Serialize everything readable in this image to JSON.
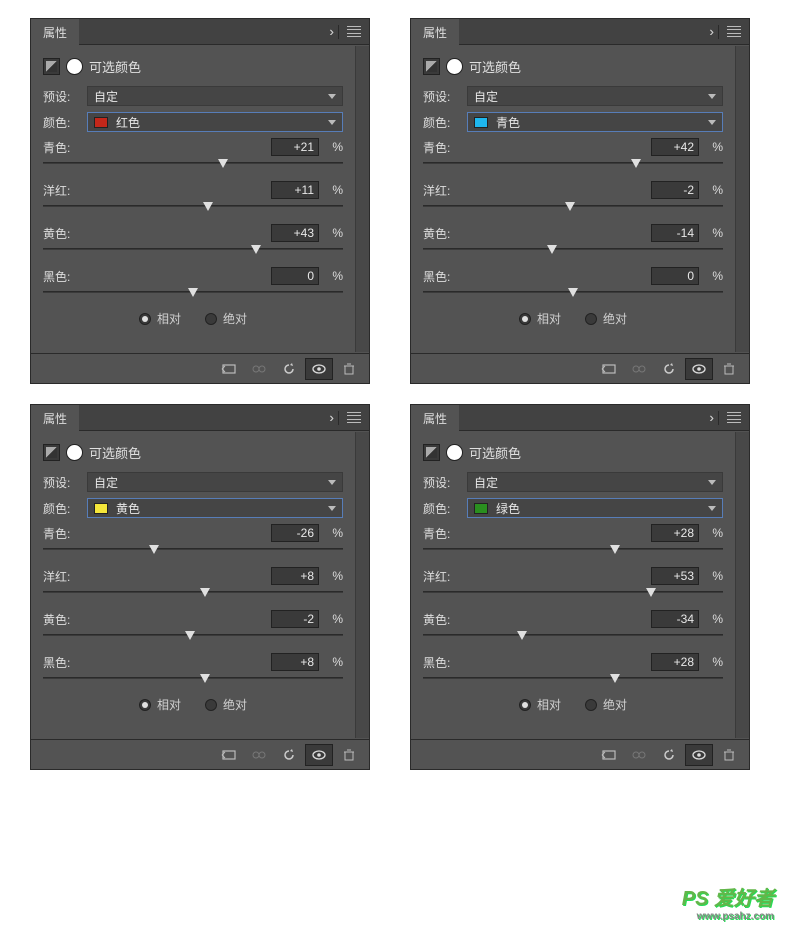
{
  "panels": [
    {
      "header": "属性",
      "title": "可选颜色",
      "preset_label": "预设:",
      "preset_value": "自定",
      "color_label": "颜色:",
      "color_value": "红色",
      "swatch": "#c3271a",
      "sliders": [
        {
          "label": "青色:",
          "value": "+21",
          "pct": "%",
          "pos": 60
        },
        {
          "label": "洋红:",
          "value": "+11",
          "pct": "%",
          "pos": 55
        },
        {
          "label": "黄色:",
          "value": "+43",
          "pct": "%",
          "pos": 71
        },
        {
          "label": "黑色:",
          "value": "0",
          "pct": "%",
          "pos": 50
        }
      ],
      "radio_rel": "相对",
      "radio_abs": "绝对"
    },
    {
      "header": "属性",
      "title": "可选颜色",
      "preset_label": "预设:",
      "preset_value": "自定",
      "color_label": "颜色:",
      "color_value": "青色",
      "swatch": "#1fb7ee",
      "sliders": [
        {
          "label": "青色:",
          "value": "+42",
          "pct": "%",
          "pos": 71
        },
        {
          "label": "洋红:",
          "value": "-2",
          "pct": "%",
          "pos": 49
        },
        {
          "label": "黄色:",
          "value": "-14",
          "pct": "%",
          "pos": 43
        },
        {
          "label": "黑色:",
          "value": "0",
          "pct": "%",
          "pos": 50
        }
      ],
      "radio_rel": "相对",
      "radio_abs": "绝对"
    },
    {
      "header": "属性",
      "title": "可选颜色",
      "preset_label": "预设:",
      "preset_value": "自定",
      "color_label": "颜色:",
      "color_value": "黄色",
      "swatch": "#f4e63a",
      "sliders": [
        {
          "label": "青色:",
          "value": "-26",
          "pct": "%",
          "pos": 37
        },
        {
          "label": "洋红:",
          "value": "+8",
          "pct": "%",
          "pos": 54
        },
        {
          "label": "黄色:",
          "value": "-2",
          "pct": "%",
          "pos": 49
        },
        {
          "label": "黑色:",
          "value": "+8",
          "pct": "%",
          "pos": 54
        }
      ],
      "radio_rel": "相对",
      "radio_abs": "绝对"
    },
    {
      "header": "属性",
      "title": "可选颜色",
      "preset_label": "预设:",
      "preset_value": "自定",
      "color_label": "颜色:",
      "color_value": "绿色",
      "swatch": "#2a8f1f",
      "sliders": [
        {
          "label": "青色:",
          "value": "+28",
          "pct": "%",
          "pos": 64
        },
        {
          "label": "洋红:",
          "value": "+53",
          "pct": "%",
          "pos": 76
        },
        {
          "label": "黄色:",
          "value": "-34",
          "pct": "%",
          "pos": 33
        },
        {
          "label": "黑色:",
          "value": "+28",
          "pct": "%",
          "pos": 64
        }
      ],
      "radio_rel": "相对",
      "radio_abs": "绝对"
    }
  ],
  "watermark": {
    "brand": "PS 爱好者",
    "url": "www.psahz.com"
  }
}
